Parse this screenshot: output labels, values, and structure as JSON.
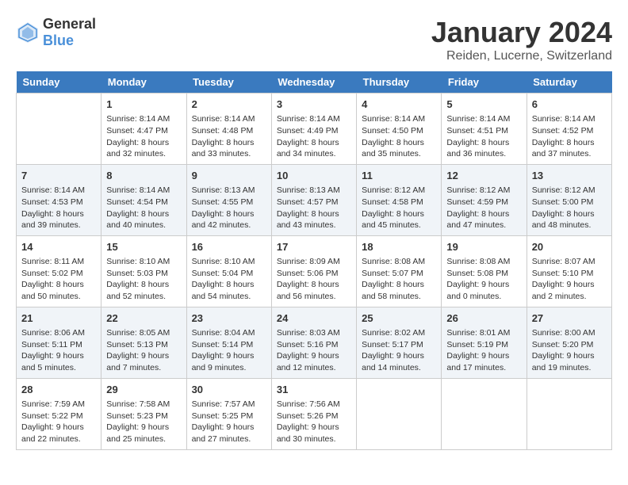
{
  "header": {
    "logo_general": "General",
    "logo_blue": "Blue",
    "month_title": "January 2024",
    "location": "Reiden, Lucerne, Switzerland"
  },
  "weekdays": [
    "Sunday",
    "Monday",
    "Tuesday",
    "Wednesday",
    "Thursday",
    "Friday",
    "Saturday"
  ],
  "weeks": [
    [
      {
        "day": "",
        "sunrise": "",
        "sunset": "",
        "daylight": ""
      },
      {
        "day": "1",
        "sunrise": "Sunrise: 8:14 AM",
        "sunset": "Sunset: 4:47 PM",
        "daylight": "Daylight: 8 hours and 32 minutes."
      },
      {
        "day": "2",
        "sunrise": "Sunrise: 8:14 AM",
        "sunset": "Sunset: 4:48 PM",
        "daylight": "Daylight: 8 hours and 33 minutes."
      },
      {
        "day": "3",
        "sunrise": "Sunrise: 8:14 AM",
        "sunset": "Sunset: 4:49 PM",
        "daylight": "Daylight: 8 hours and 34 minutes."
      },
      {
        "day": "4",
        "sunrise": "Sunrise: 8:14 AM",
        "sunset": "Sunset: 4:50 PM",
        "daylight": "Daylight: 8 hours and 35 minutes."
      },
      {
        "day": "5",
        "sunrise": "Sunrise: 8:14 AM",
        "sunset": "Sunset: 4:51 PM",
        "daylight": "Daylight: 8 hours and 36 minutes."
      },
      {
        "day": "6",
        "sunrise": "Sunrise: 8:14 AM",
        "sunset": "Sunset: 4:52 PM",
        "daylight": "Daylight: 8 hours and 37 minutes."
      }
    ],
    [
      {
        "day": "7",
        "sunrise": "Sunrise: 8:14 AM",
        "sunset": "Sunset: 4:53 PM",
        "daylight": "Daylight: 8 hours and 39 minutes."
      },
      {
        "day": "8",
        "sunrise": "Sunrise: 8:14 AM",
        "sunset": "Sunset: 4:54 PM",
        "daylight": "Daylight: 8 hours and 40 minutes."
      },
      {
        "day": "9",
        "sunrise": "Sunrise: 8:13 AM",
        "sunset": "Sunset: 4:55 PM",
        "daylight": "Daylight: 8 hours and 42 minutes."
      },
      {
        "day": "10",
        "sunrise": "Sunrise: 8:13 AM",
        "sunset": "Sunset: 4:57 PM",
        "daylight": "Daylight: 8 hours and 43 minutes."
      },
      {
        "day": "11",
        "sunrise": "Sunrise: 8:12 AM",
        "sunset": "Sunset: 4:58 PM",
        "daylight": "Daylight: 8 hours and 45 minutes."
      },
      {
        "day": "12",
        "sunrise": "Sunrise: 8:12 AM",
        "sunset": "Sunset: 4:59 PM",
        "daylight": "Daylight: 8 hours and 47 minutes."
      },
      {
        "day": "13",
        "sunrise": "Sunrise: 8:12 AM",
        "sunset": "Sunset: 5:00 PM",
        "daylight": "Daylight: 8 hours and 48 minutes."
      }
    ],
    [
      {
        "day": "14",
        "sunrise": "Sunrise: 8:11 AM",
        "sunset": "Sunset: 5:02 PM",
        "daylight": "Daylight: 8 hours and 50 minutes."
      },
      {
        "day": "15",
        "sunrise": "Sunrise: 8:10 AM",
        "sunset": "Sunset: 5:03 PM",
        "daylight": "Daylight: 8 hours and 52 minutes."
      },
      {
        "day": "16",
        "sunrise": "Sunrise: 8:10 AM",
        "sunset": "Sunset: 5:04 PM",
        "daylight": "Daylight: 8 hours and 54 minutes."
      },
      {
        "day": "17",
        "sunrise": "Sunrise: 8:09 AM",
        "sunset": "Sunset: 5:06 PM",
        "daylight": "Daylight: 8 hours and 56 minutes."
      },
      {
        "day": "18",
        "sunrise": "Sunrise: 8:08 AM",
        "sunset": "Sunset: 5:07 PM",
        "daylight": "Daylight: 8 hours and 58 minutes."
      },
      {
        "day": "19",
        "sunrise": "Sunrise: 8:08 AM",
        "sunset": "Sunset: 5:08 PM",
        "daylight": "Daylight: 9 hours and 0 minutes."
      },
      {
        "day": "20",
        "sunrise": "Sunrise: 8:07 AM",
        "sunset": "Sunset: 5:10 PM",
        "daylight": "Daylight: 9 hours and 2 minutes."
      }
    ],
    [
      {
        "day": "21",
        "sunrise": "Sunrise: 8:06 AM",
        "sunset": "Sunset: 5:11 PM",
        "daylight": "Daylight: 9 hours and 5 minutes."
      },
      {
        "day": "22",
        "sunrise": "Sunrise: 8:05 AM",
        "sunset": "Sunset: 5:13 PM",
        "daylight": "Daylight: 9 hours and 7 minutes."
      },
      {
        "day": "23",
        "sunrise": "Sunrise: 8:04 AM",
        "sunset": "Sunset: 5:14 PM",
        "daylight": "Daylight: 9 hours and 9 minutes."
      },
      {
        "day": "24",
        "sunrise": "Sunrise: 8:03 AM",
        "sunset": "Sunset: 5:16 PM",
        "daylight": "Daylight: 9 hours and 12 minutes."
      },
      {
        "day": "25",
        "sunrise": "Sunrise: 8:02 AM",
        "sunset": "Sunset: 5:17 PM",
        "daylight": "Daylight: 9 hours and 14 minutes."
      },
      {
        "day": "26",
        "sunrise": "Sunrise: 8:01 AM",
        "sunset": "Sunset: 5:19 PM",
        "daylight": "Daylight: 9 hours and 17 minutes."
      },
      {
        "day": "27",
        "sunrise": "Sunrise: 8:00 AM",
        "sunset": "Sunset: 5:20 PM",
        "daylight": "Daylight: 9 hours and 19 minutes."
      }
    ],
    [
      {
        "day": "28",
        "sunrise": "Sunrise: 7:59 AM",
        "sunset": "Sunset: 5:22 PM",
        "daylight": "Daylight: 9 hours and 22 minutes."
      },
      {
        "day": "29",
        "sunrise": "Sunrise: 7:58 AM",
        "sunset": "Sunset: 5:23 PM",
        "daylight": "Daylight: 9 hours and 25 minutes."
      },
      {
        "day": "30",
        "sunrise": "Sunrise: 7:57 AM",
        "sunset": "Sunset: 5:25 PM",
        "daylight": "Daylight: 9 hours and 27 minutes."
      },
      {
        "day": "31",
        "sunrise": "Sunrise: 7:56 AM",
        "sunset": "Sunset: 5:26 PM",
        "daylight": "Daylight: 9 hours and 30 minutes."
      },
      {
        "day": "",
        "sunrise": "",
        "sunset": "",
        "daylight": ""
      },
      {
        "day": "",
        "sunrise": "",
        "sunset": "",
        "daylight": ""
      },
      {
        "day": "",
        "sunrise": "",
        "sunset": "",
        "daylight": ""
      }
    ]
  ]
}
